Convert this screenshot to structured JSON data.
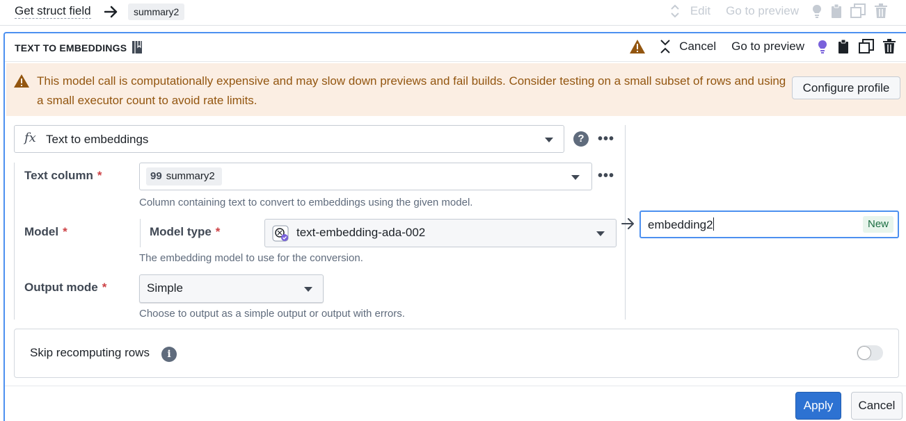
{
  "previous_board": {
    "title": "Get struct field",
    "output_chip": "summary2",
    "actions": {
      "edit_label": "Edit",
      "preview_label": "Go to preview"
    }
  },
  "board": {
    "title": "TEXT TO EMBEDDINGS",
    "actions": {
      "cancel_label": "Cancel",
      "preview_label": "Go to preview"
    },
    "warning": {
      "message": "This model call is computationally expensive and may slow down previews and fail builds. Consider testing on a small subset of rows and using a small executor count to avoid rate limits.",
      "button_label": "Configure profile"
    },
    "function": {
      "icon_text": "fx",
      "label": "Text to embeddings"
    },
    "fields": {
      "text_column": {
        "label": "Text column",
        "required_mark": "*",
        "value": "summary2",
        "hint": "Column containing text to convert to embeddings using the given model."
      },
      "model": {
        "label": "Model",
        "required_mark": "*",
        "sub_label": "Model type",
        "value": "text-embedding-ada-002",
        "hint": "The embedding model to use for the conversion."
      },
      "output_mode": {
        "label": "Output mode",
        "required_mark": "*",
        "value": "Simple",
        "hint": "Choose to output as a simple output or output with errors."
      }
    },
    "output_column": {
      "value": "embedding2",
      "tag": "New"
    },
    "skip_recompute": {
      "label": "Skip recomputing rows",
      "enabled": false
    },
    "footer": {
      "apply_label": "Apply",
      "cancel_label": "Cancel"
    }
  },
  "colors": {
    "accent": "#2d72d2",
    "focus": "#4c90f0",
    "warning_bg": "#fbeee3",
    "warning_text": "#935610",
    "lightbulb": "#7961db",
    "new_tag": "#1c6e42"
  }
}
